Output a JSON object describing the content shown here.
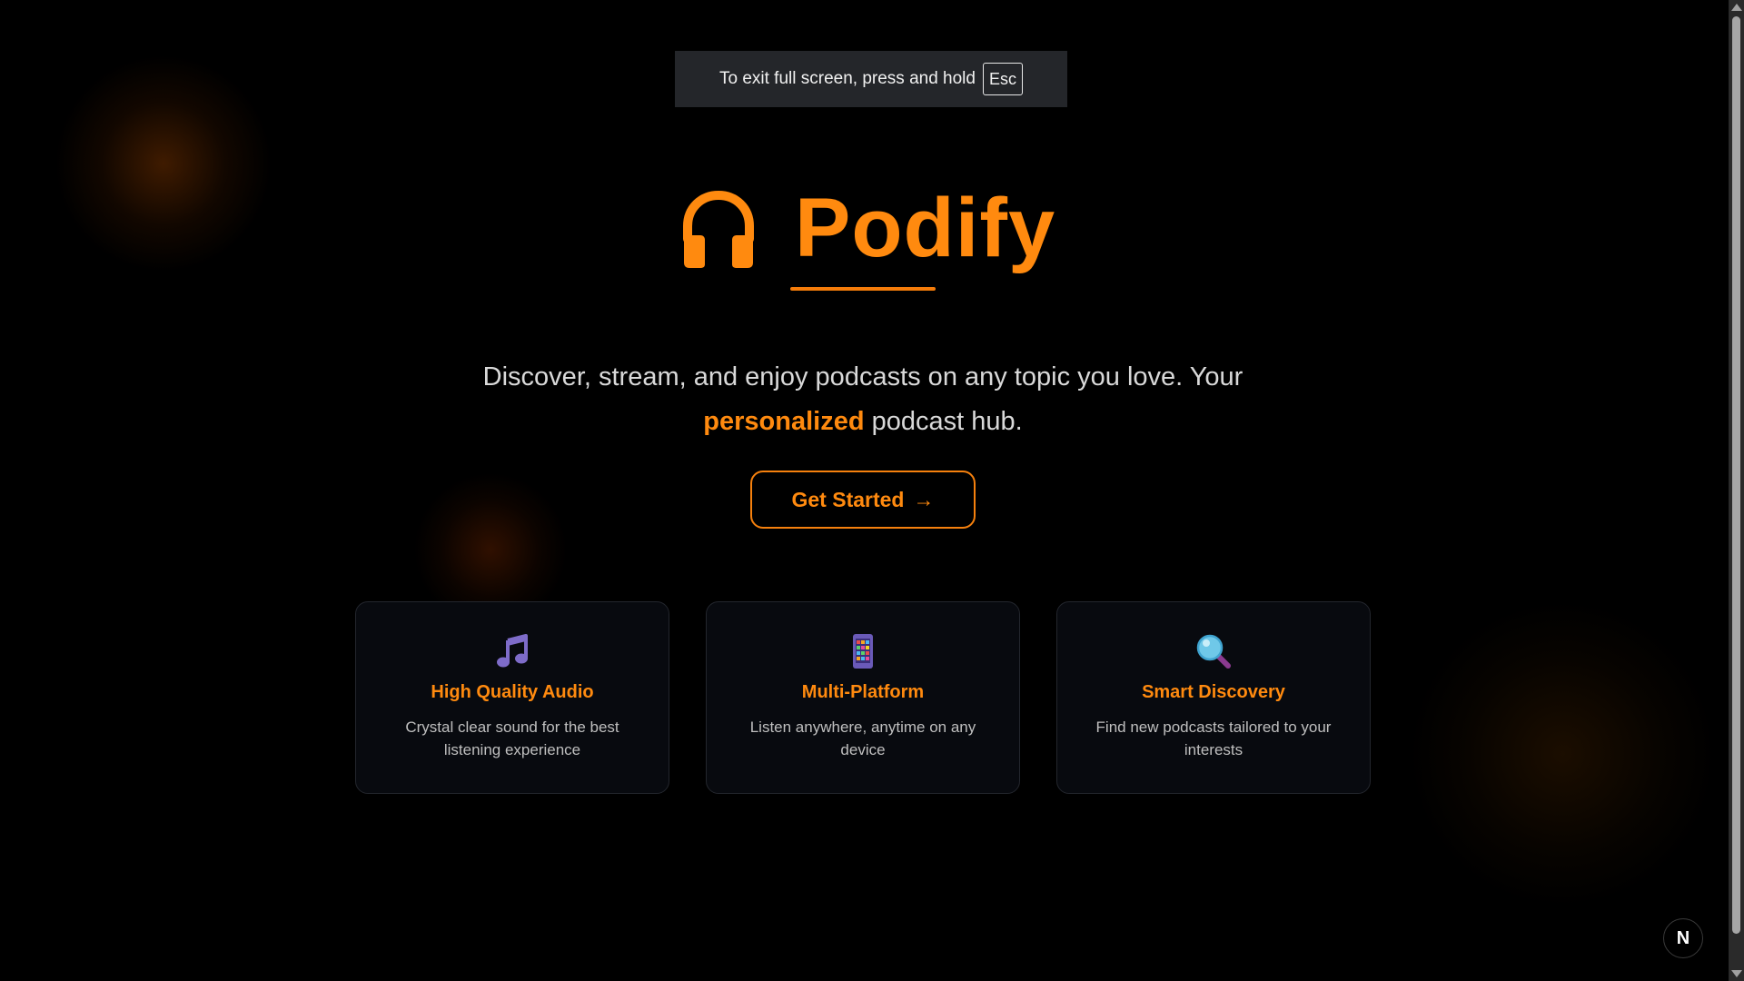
{
  "fullscreen_notice": {
    "text": "To exit full screen, press and hold",
    "key": "Esc"
  },
  "brand": {
    "name": "Podify",
    "icon": "headphones-icon",
    "accent_color": "#ff8a0f"
  },
  "hero": {
    "tagline_part1": "Discover, stream, and enjoy podcasts on any topic you love. Your",
    "tagline_highlight": "personalized",
    "tagline_part2": "podcast hub."
  },
  "cta": {
    "label": "Get Started",
    "arrow": "→"
  },
  "features": [
    {
      "icon": "music-note-icon",
      "title": "High Quality Audio",
      "description": "Crystal clear sound for the best listening experience"
    },
    {
      "icon": "mobile-phone-icon",
      "title": "Multi-Platform",
      "description": "Listen anywhere, anytime on any device"
    },
    {
      "icon": "magnifying-glass-icon",
      "title": "Smart Discovery",
      "description": "Find new podcasts tailored to your interests"
    }
  ],
  "dev_badge": {
    "letter": "N"
  }
}
